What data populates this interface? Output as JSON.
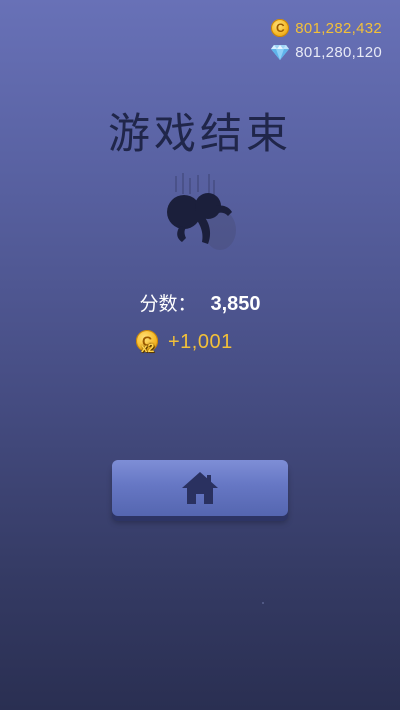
{
  "currency": {
    "coins": {
      "value": "801,282,432",
      "icon": "coin-icon",
      "icon_letter": "C",
      "color": "#f2c039"
    },
    "gems": {
      "value": "801,280,120",
      "icon": "diamond-icon",
      "color": "#e8eaf6"
    }
  },
  "title": "游戏结束",
  "character": {
    "icon": "falling-stickman-silhouette"
  },
  "score": {
    "label": "分数：",
    "value": "3,850"
  },
  "reward": {
    "icon": "coin-x2-icon",
    "icon_letter": "C",
    "multiplier": "x2",
    "value": "+1,001"
  },
  "home_button": {
    "icon": "home-icon"
  },
  "colors": {
    "background_top": "#6871b7",
    "background_bottom": "#2a2f52",
    "title": "#20264a",
    "gold": "#f2c039",
    "button": "#6677c4"
  }
}
